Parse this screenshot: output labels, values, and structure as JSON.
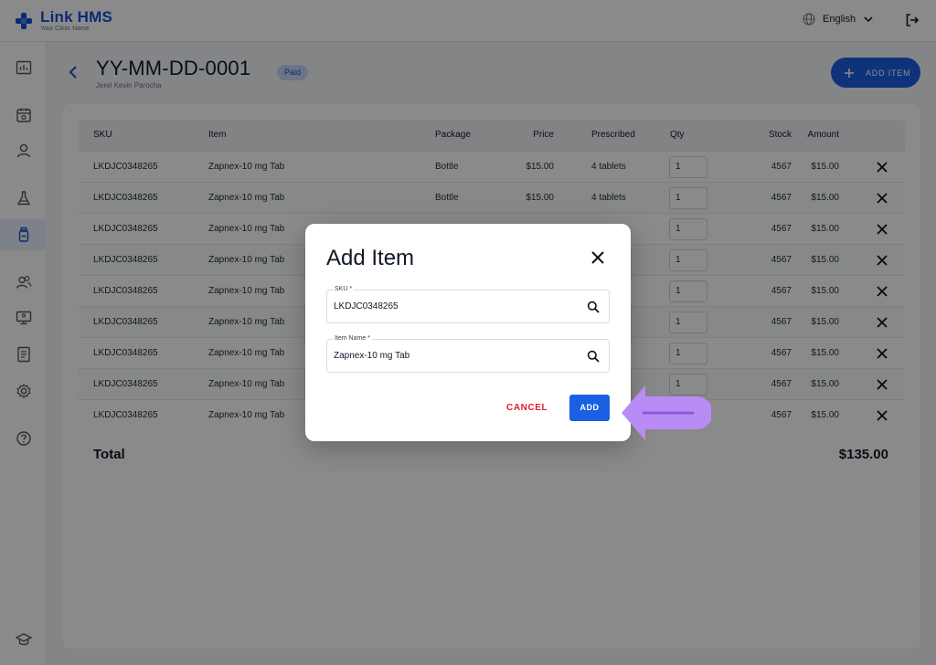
{
  "brand": {
    "name": "Link HMS",
    "subtitle": "Your Clinic Name",
    "accent": "#1b5fe3"
  },
  "header": {
    "language": "English"
  },
  "page": {
    "title": "YY-MM-DD-0001",
    "patient": "Jerel Kevin Parocha",
    "status_badge": "Paid",
    "add_item_label": "ADD ITEM"
  },
  "table": {
    "headers": {
      "sku": "SKU",
      "item": "Item",
      "package": "Package",
      "price": "Price",
      "prescribed": "Prescribed",
      "qty": "Qty",
      "stock": "Stock",
      "amount": "Amount"
    },
    "rows": [
      {
        "sku": "LKDJC0348265",
        "item": "Zapnex-10 mg Tab",
        "package": "Bottle",
        "price": "$15.00",
        "prescribed": "4 tablets",
        "qty": "1",
        "stock": "4567",
        "amount": "$15.00"
      },
      {
        "sku": "LKDJC0348265",
        "item": "Zapnex-10 mg Tab",
        "package": "Bottle",
        "price": "$15.00",
        "prescribed": "4 tablets",
        "qty": "1",
        "stock": "4567",
        "amount": "$15.00"
      },
      {
        "sku": "LKDJC0348265",
        "item": "Zapnex-10 mg Tab",
        "package": "",
        "price": "",
        "prescribed": "",
        "qty": "1",
        "stock": "4567",
        "amount": "$15.00"
      },
      {
        "sku": "LKDJC0348265",
        "item": "Zapnex-10 mg Tab",
        "package": "",
        "price": "",
        "prescribed": "",
        "qty": "1",
        "stock": "4567",
        "amount": "$15.00"
      },
      {
        "sku": "LKDJC0348265",
        "item": "Zapnex-10 mg Tab",
        "package": "",
        "price": "",
        "prescribed": "",
        "qty": "1",
        "stock": "4567",
        "amount": "$15.00"
      },
      {
        "sku": "LKDJC0348265",
        "item": "Zapnex-10 mg Tab",
        "package": "",
        "price": "",
        "prescribed": "",
        "qty": "1",
        "stock": "4567",
        "amount": "$15.00"
      },
      {
        "sku": "LKDJC0348265",
        "item": "Zapnex-10 mg Tab",
        "package": "",
        "price": "",
        "prescribed": "",
        "qty": "1",
        "stock": "4567",
        "amount": "$15.00"
      },
      {
        "sku": "LKDJC0348265",
        "item": "Zapnex-10 mg Tab",
        "package": "",
        "price": "",
        "prescribed": "",
        "qty": "1",
        "stock": "4567",
        "amount": "$15.00"
      },
      {
        "sku": "LKDJC0348265",
        "item": "Zapnex-10 mg Tab",
        "package": "",
        "price": "",
        "prescribed": "",
        "qty": "",
        "stock": "4567",
        "amount": "$15.00"
      }
    ],
    "total_label": "Total",
    "total_value": "$135.00"
  },
  "modal": {
    "title": "Add Item",
    "sku_label": "SKU *",
    "sku_value": "LKDJC0348265",
    "item_label": "Item Name *",
    "item_value": "Zapnex-10 mg Tab",
    "cancel_label": "CANCEL",
    "add_label": "ADD"
  },
  "annotation": {
    "pointer_color": "#b98cf5"
  }
}
